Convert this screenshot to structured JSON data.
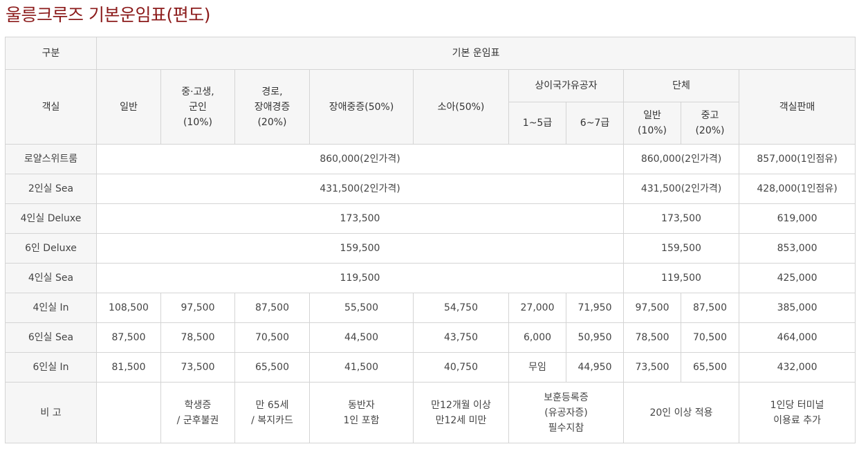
{
  "title": "울릉크루즈 기본운임표(편도)",
  "header": {
    "category": "구분",
    "basic_fare": "기본 운임표",
    "cabin": "객실",
    "general": "일반",
    "student_military": [
      "중·고생,",
      "군인",
      "(10%)"
    ],
    "senior_disabled": [
      "경로,",
      "장애경증",
      "(20%)"
    ],
    "disabled_severe": "장애중증(50%)",
    "child": "소아(50%)",
    "veterans": "상이국가유공자",
    "veterans_grade1": "1~5급",
    "veterans_grade2": "6~7급",
    "group": "단체",
    "group_general": [
      "일반",
      "(10%)"
    ],
    "group_school": [
      "중고",
      "(20%)"
    ],
    "cabin_sale": "객실판매"
  },
  "rows": [
    {
      "cabin": "로얄스위트룸",
      "merged_fare": "860,000(2인가격)",
      "group_fare": "860,000(2인가격)",
      "cabin_sale": "857,000(1인점유)"
    },
    {
      "cabin": "2인실 Sea",
      "merged_fare": "431,500(2인가격)",
      "group_fare": "431,500(2인가격)",
      "cabin_sale": "428,000(1인점유)"
    },
    {
      "cabin": "4인실 Deluxe",
      "merged_fare": "173,500",
      "group_fare": "173,500",
      "cabin_sale": "619,000"
    },
    {
      "cabin": "6인 Deluxe",
      "merged_fare": "159,500",
      "group_fare": "159,500",
      "cabin_sale": "853,000"
    },
    {
      "cabin": "4인실 Sea",
      "merged_fare": "119,500",
      "group_fare": "119,500",
      "cabin_sale": "425,000"
    },
    {
      "cabin": "4인실 In",
      "general": "108,500",
      "student": "97,500",
      "senior": "87,500",
      "disabled": "55,500",
      "child": "54,750",
      "vet1": "27,000",
      "vet2": "71,950",
      "group_general": "97,500",
      "group_school": "87,500",
      "cabin_sale": "385,000"
    },
    {
      "cabin": "6인실 Sea",
      "general": "87,500",
      "student": "78,500",
      "senior": "70,500",
      "disabled": "44,500",
      "child": "43,750",
      "vet1": "6,000",
      "vet2": "50,950",
      "group_general": "78,500",
      "group_school": "70,500",
      "cabin_sale": "464,000"
    },
    {
      "cabin": "6인실 In",
      "general": "81,500",
      "student": "73,500",
      "senior": "65,500",
      "disabled": "41,500",
      "child": "40,750",
      "vet1": "무임",
      "vet2": "44,950",
      "group_general": "73,500",
      "group_school": "65,500",
      "cabin_sale": "432,000"
    }
  ],
  "notes": {
    "label": "비 고",
    "general": "",
    "student": [
      "학생증",
      "/ 군후불권"
    ],
    "senior": [
      "만 65세",
      "/ 복지카드"
    ],
    "disabled": [
      "동반자",
      "1인 포함"
    ],
    "child": [
      "만12개월 이상",
      "만12세 미만"
    ],
    "veterans": [
      "보훈등록증",
      "(유공자증)",
      "필수지참"
    ],
    "group": "20인 이상 적용",
    "cabin_sale": [
      "1인당 터미널",
      "이용료 추가"
    ]
  }
}
